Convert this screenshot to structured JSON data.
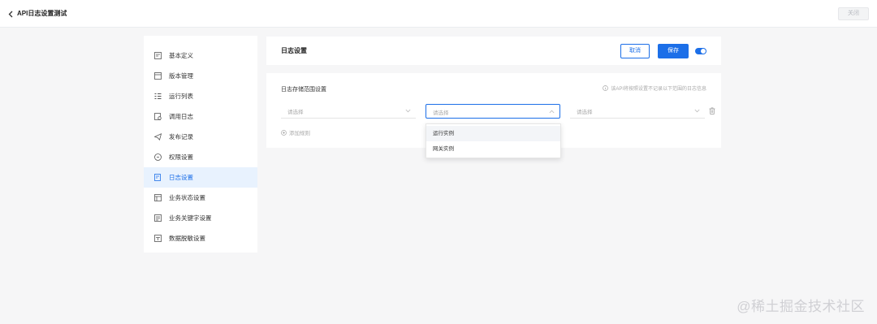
{
  "topbar": {
    "title": "API日志设置测试",
    "close_label": "关闭"
  },
  "sidebar": {
    "items": [
      {
        "label": "基本定义",
        "icon": "form-icon"
      },
      {
        "label": "版本管理",
        "icon": "version-icon"
      },
      {
        "label": "运行列表",
        "icon": "list-icon"
      },
      {
        "label": "调用日志",
        "icon": "log-icon"
      },
      {
        "label": "发布记录",
        "icon": "send-icon"
      },
      {
        "label": "权限设置",
        "icon": "permission-icon"
      },
      {
        "label": "日志设置",
        "icon": "log-settings-icon",
        "active": true
      },
      {
        "label": "业务状态设置",
        "icon": "status-icon"
      },
      {
        "label": "业务关键字设置",
        "icon": "keyword-icon"
      },
      {
        "label": "数据脱敏设置",
        "icon": "mask-icon"
      }
    ]
  },
  "header": {
    "title": "日志设置",
    "cancel_label": "取消",
    "save_label": "保存",
    "toggle_on": true
  },
  "log_scope": {
    "title": "日志存储范围设置",
    "hint": "该API将按照设置不记录以下范围的日志信息",
    "selects": [
      {
        "placeholder": "请选择"
      },
      {
        "placeholder": "请选择"
      },
      {
        "placeholder": "请选择"
      }
    ],
    "add_rule_label": "添加规则"
  },
  "dropdown": {
    "options": [
      "运行实例",
      "网关实例"
    ]
  },
  "watermark": "@稀土掘金技术社区",
  "colors": {
    "accent": "#1c6fe8",
    "active_bg": "#e8f2fe",
    "page_bg": "#f6f6f7"
  }
}
